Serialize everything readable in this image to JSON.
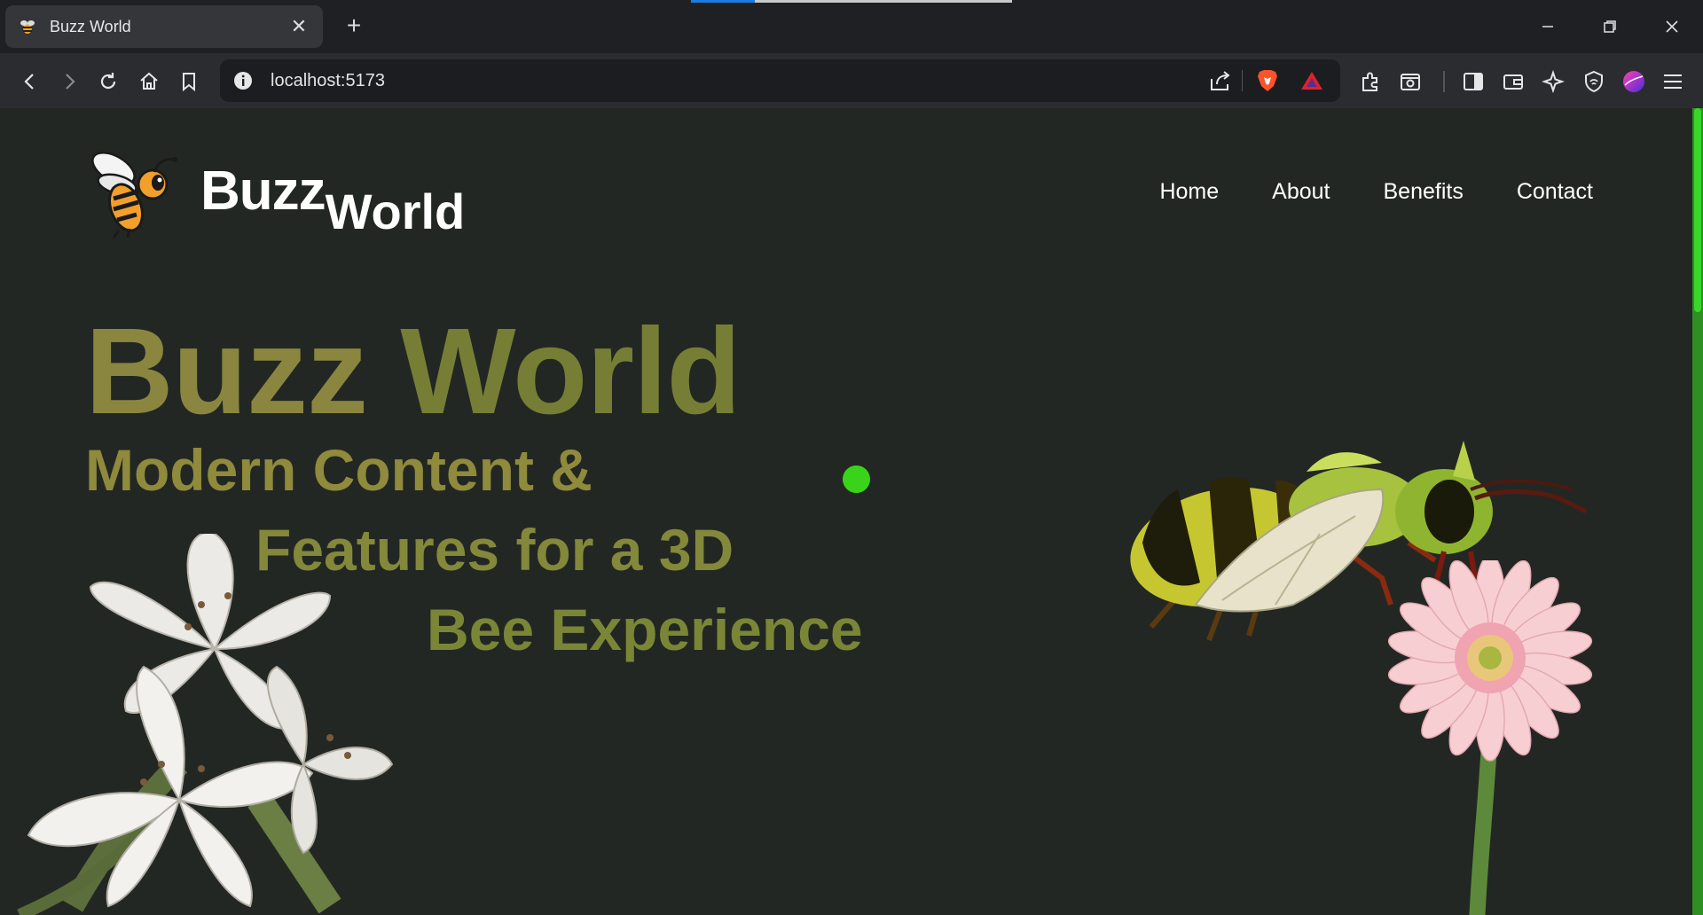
{
  "browser": {
    "tab_title": "Buzz World",
    "url": "localhost:5173"
  },
  "site": {
    "brand_part1": "Buzz",
    "brand_part2": "World",
    "nav": [
      {
        "label": "Home"
      },
      {
        "label": "About"
      },
      {
        "label": "Benefits"
      },
      {
        "label": "Contact"
      }
    ]
  },
  "hero": {
    "title_part1": "Buzz",
    "title_part2": "World",
    "subtitle_line1": "Modern Content &",
    "subtitle_line2": "Features for a 3D",
    "subtitle_line3": "Bee Experience"
  },
  "colors": {
    "page_background": "#232723",
    "accent_green": "#39d41a",
    "title_olive": "#8a8640"
  },
  "icons": [
    "bee-favicon",
    "close-icon",
    "plus-icon",
    "minimize-icon",
    "restore-icon",
    "window-close-icon",
    "back-icon",
    "forward-icon",
    "reload-icon",
    "home-icon",
    "bookmark-icon",
    "info-icon",
    "share-icon",
    "brave-shields-icon",
    "brave-rewards-icon",
    "extensions-icon",
    "screenshot-icon",
    "sidebar-icon",
    "wallet-icon",
    "leo-ai-icon",
    "vpn-icon",
    "profile-avatar-icon",
    "menu-icon"
  ]
}
